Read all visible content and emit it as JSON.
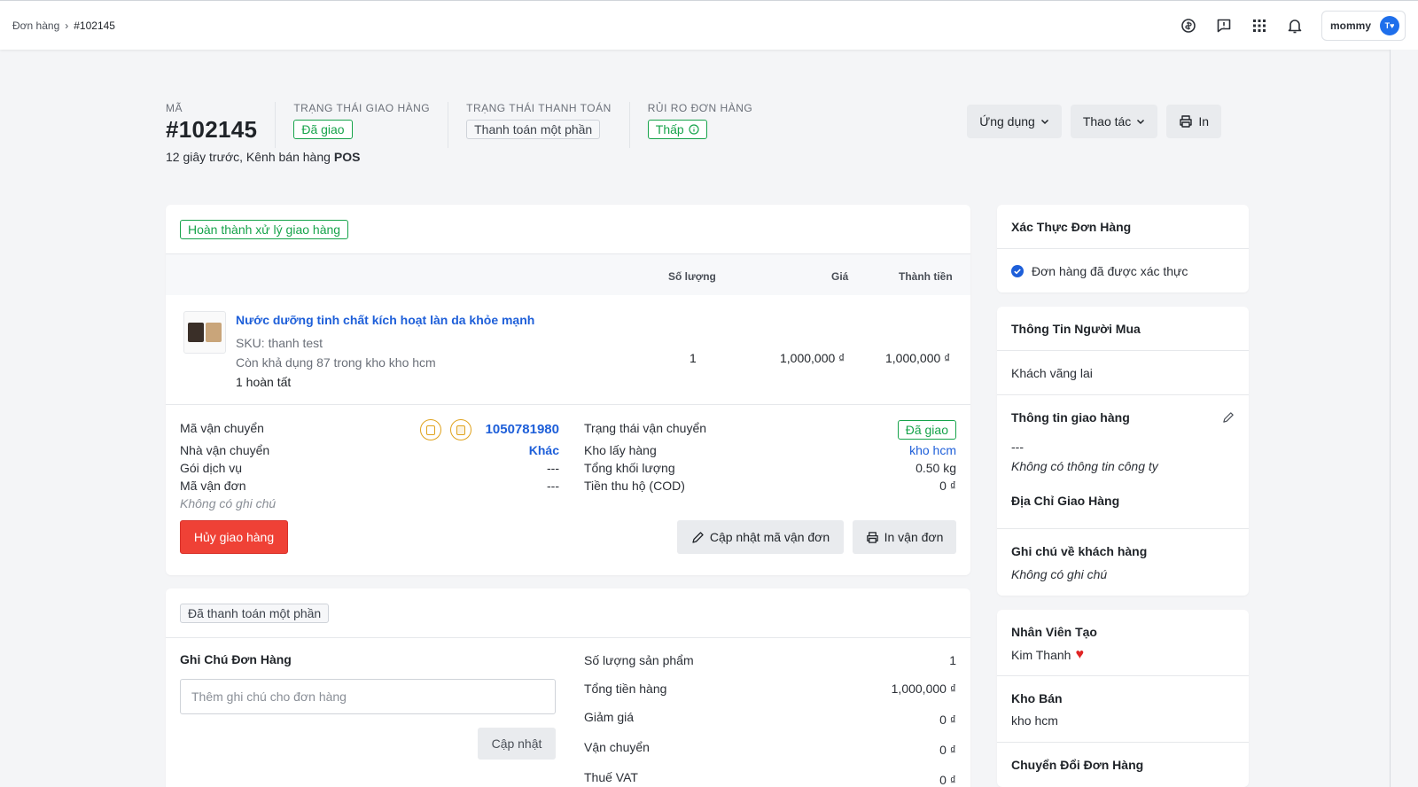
{
  "breadcrumb": {
    "root": "Đơn hàng",
    "current": "#102145"
  },
  "topbar": {
    "user_name": "mommy",
    "avatar_initials": "T"
  },
  "header": {
    "code_label": "MÃ",
    "order_code": "#102145",
    "delivery_status_label": "TRẠNG THÁI GIAO HÀNG",
    "delivery_status": "Đã giao",
    "payment_status_label": "TRẠNG THÁI THANH TOÁN",
    "payment_status": "Thanh toán một phần",
    "risk_label": "RỦI RO ĐƠN HÀNG",
    "risk": "Thấp",
    "subline": "12 giây trước, Kênh bán hàng",
    "channel": "POS",
    "actions": {
      "apps": "Ứng dụng",
      "operations": "Thao tác",
      "print": "In"
    }
  },
  "fulfillment": {
    "status_badge": "Hoàn thành xử lý giao hàng",
    "columns": {
      "qty": "Số lượng",
      "price": "Giá",
      "total": "Thành tiền"
    },
    "item": {
      "name": "Nước dưỡng tinh chất kích hoạt làn da khỏe mạnh",
      "sku": "SKU: thanh test",
      "stock": "Còn khả dụng 87 trong kho kho hcm",
      "fulfilled": "1 hoàn tất",
      "qty": "1",
      "price": "1,000,000 ₫",
      "total": "1,000,000 ₫"
    },
    "shipping": {
      "tracking_label": "Mã vận chuyển",
      "tracking_code": "1050781980",
      "carrier_label": "Nhà vận chuyển",
      "carrier": "Khác",
      "service_label": "Gói dịch vụ",
      "service": "---",
      "waybill_label": "Mã vận đơn",
      "waybill": "---",
      "note": "Không có ghi chú",
      "ship_status_label": "Trạng thái vận chuyển",
      "ship_status": "Đã giao",
      "warehouse_label": "Kho lấy hàng",
      "warehouse": "kho hcm",
      "weight_label": "Tổng khối lượng",
      "weight": "0.50 kg",
      "cod_label": "Tiền thu hộ (COD)",
      "cod": "0 ₫",
      "cancel_button": "Hủy giao hàng",
      "update_button": "Cập nhật mã vận đơn",
      "print_button": "In vận đơn"
    }
  },
  "payment": {
    "status_badge": "Đã thanh toán một phần",
    "note_title": "Ghi Chú Đơn Hàng",
    "note_placeholder": "Thêm ghi chú cho đơn hàng",
    "update_button": "Cập nhật",
    "summary": [
      {
        "label": "Số lượng sản phẩm",
        "value": "1"
      },
      {
        "label": "Tổng tiền hàng",
        "value": "1,000,000 ₫"
      },
      {
        "label": "Giảm giá",
        "value": "0 ₫"
      },
      {
        "label": "Vận chuyển",
        "value": "0 ₫"
      },
      {
        "label": "Thuế VAT",
        "value": "0 ₫"
      }
    ]
  },
  "sidebar": {
    "verify_title": "Xác Thực Đơn Hàng",
    "verify_text": "Đơn hàng đã được xác thực",
    "buyer_title": "Thông Tin Người Mua",
    "buyer": "Khách vãng lai",
    "shipping_info_title": "Thông tin giao hàng",
    "shipping_info_value": "---",
    "company_note": "Không có thông tin công ty",
    "address_title": "Địa Chỉ Giao Hàng",
    "customer_note_title": "Ghi chú về khách hàng",
    "customer_note": "Không có ghi chú",
    "staff_title": "Nhân Viên Tạo",
    "staff_name": "Kim Thanh",
    "warehouse_title": "Kho Bán",
    "warehouse": "kho hcm",
    "convert_title": "Chuyển Đổi Đơn Hàng"
  },
  "colors": {
    "link": "#1e5fd9",
    "success": "#16a34a",
    "danger": "#ef4136",
    "warning": "#e0a21b"
  }
}
